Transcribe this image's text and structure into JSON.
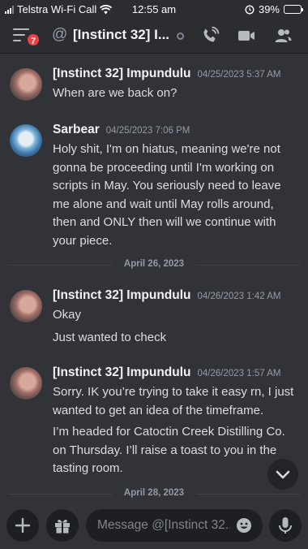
{
  "status_bar": {
    "carrier": "Telstra Wi-Fi Call",
    "time": "12:55 am",
    "battery": "39%",
    "battery_level": 0.39
  },
  "header": {
    "title": "[Instinct 32] I...",
    "unread_badge": "7"
  },
  "messages": [
    {
      "author": "[Instinct 32] Impundulu",
      "timestamp": "04/25/2023 5:37 AM",
      "lines": [
        "When are we back on?"
      ]
    },
    {
      "author": "Sarbear",
      "timestamp": "04/25/2023 7:06 PM",
      "lines": [
        "Holy shit, I'm on hiatus, meaning we're not gonna be proceeding until I'm working on scripts in May. You seriously need to leave me alone and wait until May rolls around, then and ONLY then will we continue with your piece."
      ]
    },
    {
      "author": "[Instinct 32] Impundulu",
      "timestamp": "04/26/2023 1:42 AM",
      "lines": [
        "Okay",
        "Just wanted to check"
      ]
    },
    {
      "author": "[Instinct 32] Impundulu",
      "timestamp": "04/26/2023 1:57 AM",
      "lines": [
        "Sorry.  IK you’re trying to take it easy rn, I just wanted to get an idea of the timeframe.",
        "I’m headed for Catoctin Creek Distilling Co. on Thursday.  I’ll raise a toast to you in the tasting room."
      ]
    }
  ],
  "date_dividers": [
    "April 26, 2023",
    "April 28, 2023"
  ],
  "composer": {
    "placeholder": "Message @[Instinct 32.."
  },
  "colors": {
    "background": "#313338",
    "header": "#2b2d31",
    "badge": "#f23f43",
    "input": "#1e1f22",
    "battery": "#ffd60a"
  },
  "icons": [
    "signal-icon",
    "wifi-icon",
    "alarm-icon",
    "battery-icon",
    "hamburger-icon",
    "at-icon",
    "status-offline-icon",
    "voice-call-icon",
    "video-call-icon",
    "members-icon",
    "chevron-down-icon",
    "plus-icon",
    "gift-icon",
    "emoji-icon",
    "microphone-icon"
  ]
}
